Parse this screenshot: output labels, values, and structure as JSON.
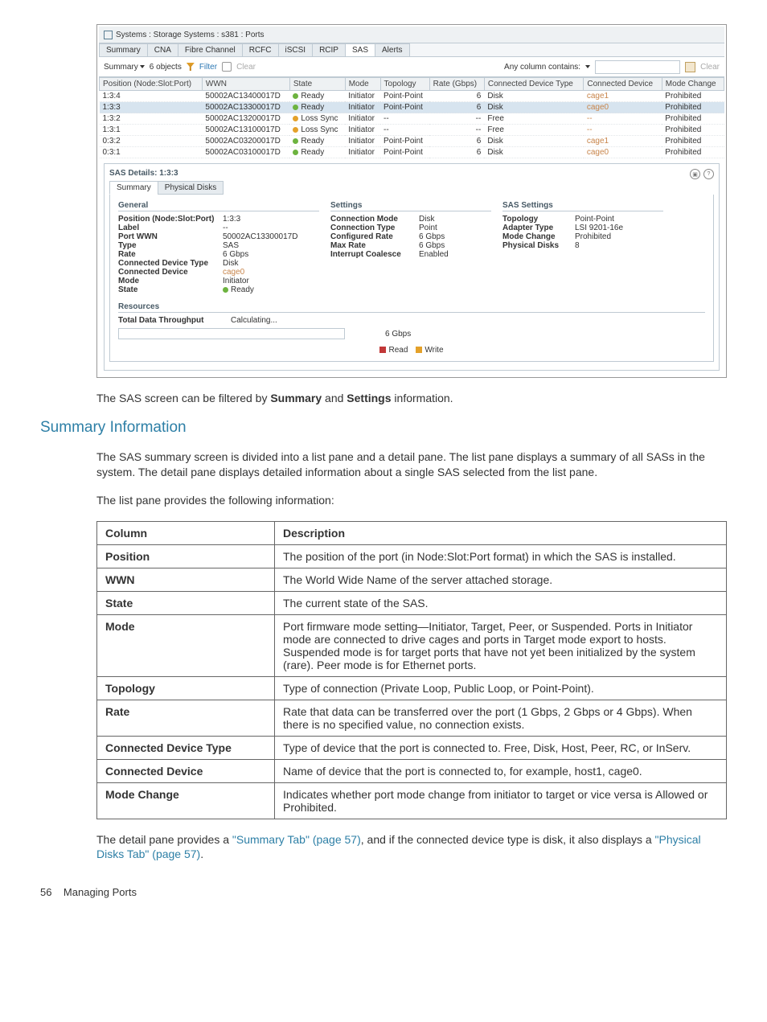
{
  "breadcrumb": "Systems : Storage Systems : s381 : Ports",
  "tabs": [
    "Summary",
    "CNA",
    "Fibre Channel",
    "RCFC",
    "iSCSI",
    "RCIP",
    "SAS",
    "Alerts"
  ],
  "active_tab": "SAS",
  "toolbar": {
    "summary_label": "Summary",
    "objects": "6 objects",
    "filter": "Filter",
    "clear": "Clear",
    "any_col": "Any column contains:",
    "clear_right": "Clear"
  },
  "list_headers": [
    "Position (Node:Slot:Port)",
    "WWN",
    "State",
    "Mode",
    "Topology",
    "Rate (Gbps)",
    "Connected Device Type",
    "Connected Device",
    "Mode Change"
  ],
  "list_rows": [
    {
      "pos": "1:3:4",
      "wwn": "50002AC13400017D",
      "state": "Ready",
      "state_c": "green",
      "mode": "Initiator",
      "topo": "Point-Point",
      "rate": "6",
      "cdt": "Disk",
      "cd": "cage1",
      "mc": "Prohibited",
      "sel": false
    },
    {
      "pos": "1:3:3",
      "wwn": "50002AC13300017D",
      "state": "Ready",
      "state_c": "green",
      "mode": "Initiator",
      "topo": "Point-Point",
      "rate": "6",
      "cdt": "Disk",
      "cd": "cage0",
      "mc": "Prohibited",
      "sel": true
    },
    {
      "pos": "1:3:2",
      "wwn": "50002AC13200017D",
      "state": "Loss Sync",
      "state_c": "orange",
      "mode": "Initiator",
      "topo": "--",
      "rate": "--",
      "cdt": "Free",
      "cd": "--",
      "mc": "Prohibited",
      "sel": false
    },
    {
      "pos": "1:3:1",
      "wwn": "50002AC13100017D",
      "state": "Loss Sync",
      "state_c": "orange",
      "mode": "Initiator",
      "topo": "--",
      "rate": "--",
      "cdt": "Free",
      "cd": "--",
      "mc": "Prohibited",
      "sel": false
    },
    {
      "pos": "0:3:2",
      "wwn": "50002AC03200017D",
      "state": "Ready",
      "state_c": "green",
      "mode": "Initiator",
      "topo": "Point-Point",
      "rate": "6",
      "cdt": "Disk",
      "cd": "cage1",
      "mc": "Prohibited",
      "sel": false
    },
    {
      "pos": "0:3:1",
      "wwn": "50002AC03100017D",
      "state": "Ready",
      "state_c": "green",
      "mode": "Initiator",
      "topo": "Point-Point",
      "rate": "6",
      "cdt": "Disk",
      "cd": "cage0",
      "mc": "Prohibited",
      "sel": false
    }
  ],
  "detail": {
    "title": "SAS Details: 1:3:3",
    "sub_tabs": [
      "Summary",
      "Physical Disks"
    ],
    "active_sub": "Summary",
    "general_title": "General",
    "settings_title": "Settings",
    "sas_settings_title": "SAS Settings",
    "general": {
      "Position (Node:Slot:Port)": "1:3:3",
      "Label": "--",
      "Port WWN": "50002AC13300017D",
      "Type": "SAS",
      "Rate": "6 Gbps",
      "Connected Device Type": "Disk",
      "Connected Device": "cage0",
      "Mode": "Initiator",
      "State": "Ready"
    },
    "settings": {
      "Connection Mode": "Disk",
      "Connection Type": "Point",
      "Configured Rate": "6 Gbps",
      "Max Rate": "6 Gbps",
      "Interrupt Coalesce": "Enabled"
    },
    "sas_settings": {
      "Topology": "Point-Point",
      "Adapter Type": "LSI 9201-16e",
      "Mode Change": "Prohibited",
      "Physical Disks": "8"
    },
    "resources_title": "Resources",
    "tdt_label": "Total Data Throughput",
    "tdt_value": "Calculating...",
    "bar_right_label": "6 Gbps",
    "legend": {
      "read": "Read",
      "write": "Write"
    }
  },
  "doc": {
    "line1_a": "The SAS screen can be filtered by ",
    "line1_b_strong": "Summary",
    "line1_c": " and ",
    "line1_d_strong": "Settings",
    "line1_e": " information.",
    "h_summary": "Summary Information",
    "p2": "The SAS summary screen is divided into a list pane and a detail pane. The list pane displays a summary of all SASs in the system. The detail pane displays detailed information about a single SAS selected from the list pane.",
    "p3": "The list pane provides the following information:",
    "table_header": {
      "c1": "Column",
      "c2": "Description"
    },
    "table_rows": [
      {
        "c": "Position",
        "d": "The position of the port (in Node:Slot:Port format) in which the SAS is installed."
      },
      {
        "c": "WWN",
        "d": "The World Wide Name of the server attached storage."
      },
      {
        "c": "State",
        "d": "The current state of the SAS."
      },
      {
        "c": "Mode",
        "d": "Port firmware mode setting—Initiator, Target, Peer, or Suspended. Ports in Initiator mode are connected to drive cages and ports in Target mode export to hosts. Suspended mode is for target ports that have not yet been initialized by the system (rare). Peer mode is for Ethernet ports."
      },
      {
        "c": "Topology",
        "d": "Type of connection (Private Loop, Public Loop, or Point-Point)."
      },
      {
        "c": "Rate",
        "d": "Rate that data can be transferred over the port (1 Gbps, 2 Gbps or 4 Gbps). When there is no specified value, no connection exists."
      },
      {
        "c": "Connected Device Type",
        "d": "Type of device that the port is connected to. Free, Disk, Host, Peer, RC, or InServ."
      },
      {
        "c": "Connected Device",
        "d": "Name of device that the port is connected to, for example, host1, cage0."
      },
      {
        "c": "Mode Change",
        "d": "Indicates whether port mode change from initiator to target or vice versa is Allowed or Prohibited."
      }
    ],
    "p4_a": "The detail pane provides a ",
    "p4_link1": "\"Summary Tab\" (page 57)",
    "p4_b": ", and if the connected device type is disk, it also displays a ",
    "p4_link2": "\"Physical Disks Tab\" (page 57)",
    "p4_c": ".",
    "footer_page": "56",
    "footer_text": "Managing Ports"
  }
}
